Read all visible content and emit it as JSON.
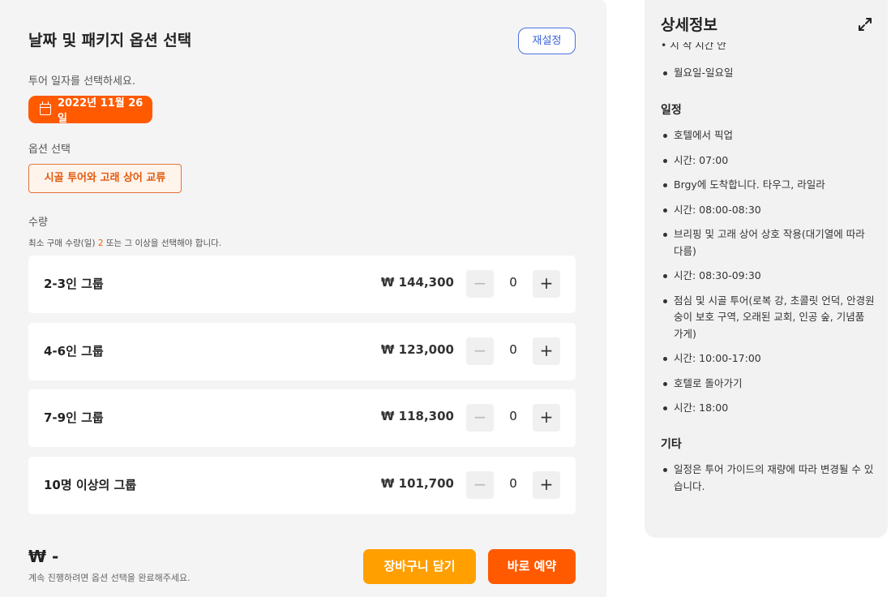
{
  "booking": {
    "title": "날짜 및 패키지 옵션 선택",
    "reset_label": "재설정",
    "date_prompt": "투어 일자를 선택하세요.",
    "selected_date": "2022년 11월 26일",
    "option_label": "옵션 선택",
    "selected_option": "시골 투어와 고래 상어 교류",
    "quantity_label": "수량",
    "min_note_prefix": "최소 구매 수량(일) ",
    "min_note_num": "2",
    "min_note_suffix": " 또는 그 이상을 선택해야 합니다.",
    "groups": [
      {
        "name": "2-3인 그룹",
        "price": "₩ 144,300",
        "qty": "0",
        "minus": "−",
        "plus": "+"
      },
      {
        "name": "4-6인 그룹",
        "price": "₩ 123,000",
        "qty": "0",
        "minus": "−",
        "plus": "+"
      },
      {
        "name": "7-9인 그룹",
        "price": "₩ 118,300",
        "qty": "0",
        "minus": "−",
        "plus": "+"
      },
      {
        "name": "10명 이상의 그룹",
        "price": "₩ 101,700",
        "qty": "0",
        "minus": "−",
        "plus": "+"
      }
    ],
    "total": "₩ -",
    "total_note": "계속 진행하려면 옵션 선택을 완료해주세요.",
    "cart_label": "장바구니 담기",
    "book_label": "바로 예약"
  },
  "details": {
    "title": "상세정보",
    "cut_top": "• 시 작 시간 안",
    "days": [
      "월요일-일요일"
    ],
    "schedule_heading": "일정",
    "schedule": [
      "호텔에서 픽업",
      "시간: 07:00",
      "Brgy에 도착합니다. 타우그, 라일라",
      "시간: 08:00-08:30",
      "브리핑 및 고래 상어 상호 작용(대기열에 따라 다름)",
      "시간: 08:30-09:30",
      "점심 및 시골 투어(로복 강, 초콜릿 언덕, 안경원숭이 보호 구역, 오래된 교회, 인공 숲, 기념품 가게)",
      "시간: 10:00-17:00",
      "호텔로 돌아가기",
      "시간: 18:00"
    ],
    "other_heading": "기타",
    "other": [
      "일정은 투어 가이드의 재량에 따라 변경될 수 있습니다."
    ]
  },
  "colors": {
    "accent": "#ff5a00",
    "cart": "#ff9f00",
    "link": "#3b62d9"
  },
  "icons": {
    "calendar": "calendar-icon",
    "expand": "expand-icon"
  }
}
